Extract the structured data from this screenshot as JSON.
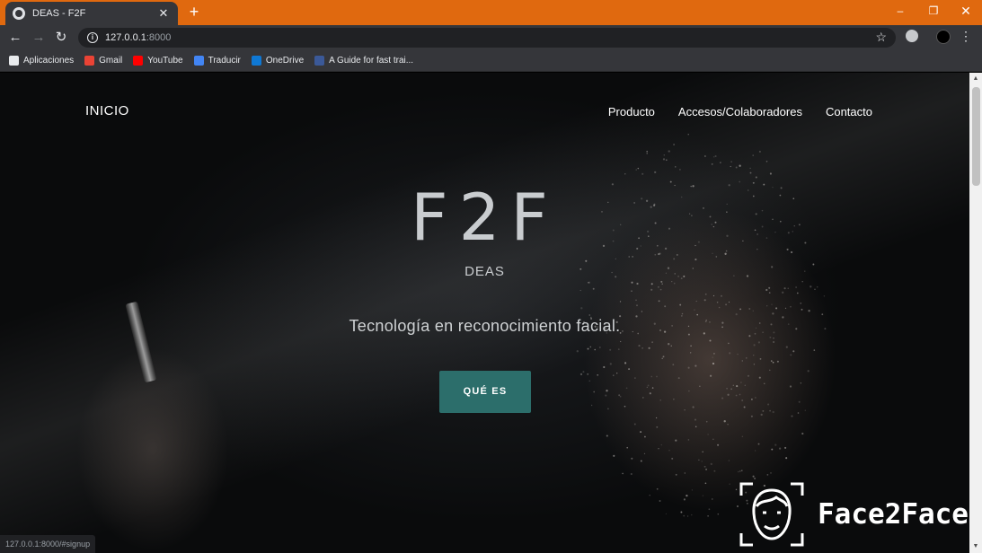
{
  "browser": {
    "tab": {
      "title": "DEAS - F2F",
      "favicon": "globe-icon",
      "close": "✕"
    },
    "new_tab": "+",
    "window_controls": {
      "minimize": "–",
      "maximize": "❐",
      "close": "✕"
    },
    "address": {
      "host": "127.0.0.1",
      "port": ":8000"
    },
    "bookmarks": [
      {
        "label": "Aplicaciones",
        "icon": "apps-grid-icon",
        "color": "#e8eaed"
      },
      {
        "label": "Gmail",
        "icon": "gmail-icon",
        "color": "#ea4335"
      },
      {
        "label": "YouTube",
        "icon": "youtube-icon",
        "color": "#ff0000"
      },
      {
        "label": "Traducir",
        "icon": "translate-icon",
        "color": "#4285f4"
      },
      {
        "label": "OneDrive",
        "icon": "onedrive-icon",
        "color": "#0f78d4"
      },
      {
        "label": "A Guide for fast trai...",
        "icon": "page-icon",
        "color": "#3b5998"
      }
    ],
    "status_url": "127.0.0.1:8000/#signup"
  },
  "site": {
    "nav": {
      "home": "INICIO",
      "links": [
        "Producto",
        "Accesos/Colaboradores",
        "Contacto"
      ]
    },
    "hero": {
      "logo": "F2F",
      "subtitle": "DEAS",
      "tagline": "Tecnología en reconocimiento facial.",
      "cta": "QUÉ ES"
    },
    "accent_color": "#2c6e6b"
  },
  "watermark": {
    "text": "Face2Face"
  },
  "colors": {
    "titlebar": "#e0690f",
    "toolbar": "#35363a"
  }
}
